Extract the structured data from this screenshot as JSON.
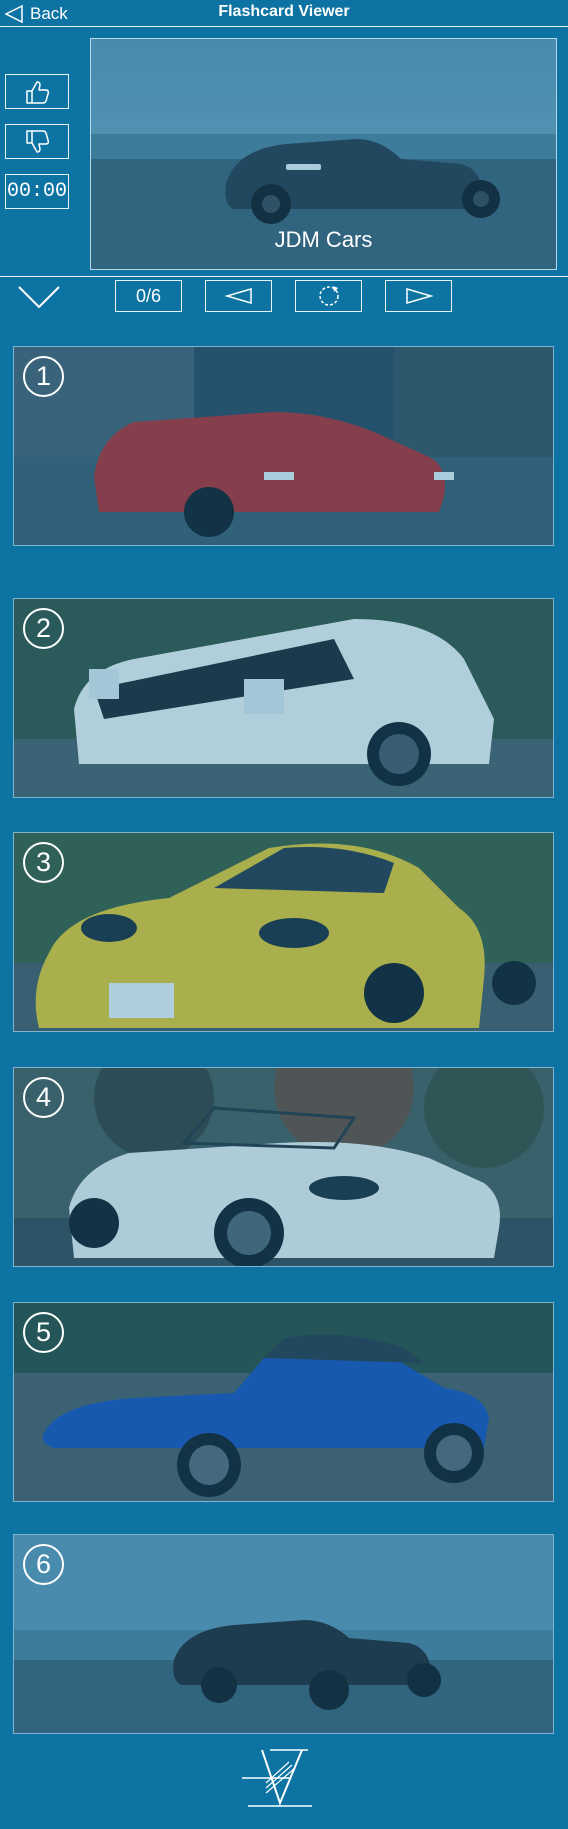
{
  "header": {
    "back_label": "Back",
    "title": "Flashcard Viewer"
  },
  "sidebar": {
    "like_icon": "thumbs-up-icon",
    "dislike_icon": "thumbs-down-icon",
    "timer": "00:00"
  },
  "card": {
    "deck_title": "JDM Cars"
  },
  "controls": {
    "progress": "0/6",
    "prev_icon": "triangle-left-icon",
    "reset_icon": "refresh-icon",
    "next_icon": "triangle-right-icon"
  },
  "tiles": [
    {
      "number": "1",
      "car_color": "#b52a2a"
    },
    {
      "number": "2",
      "car_color": "#f2f2f2"
    },
    {
      "number": "3",
      "car_color": "#e5c72c"
    },
    {
      "number": "4",
      "car_color": "#eeeeee"
    },
    {
      "number": "5",
      "car_color": "#1e4fb6"
    },
    {
      "number": "6",
      "car_color": "#252a33"
    }
  ],
  "colors": {
    "background": "#0c73a2",
    "overlay": "#0c73a2",
    "line": "#e8f3f8"
  },
  "footer": {
    "logo_icon": "app-logo-icon"
  }
}
